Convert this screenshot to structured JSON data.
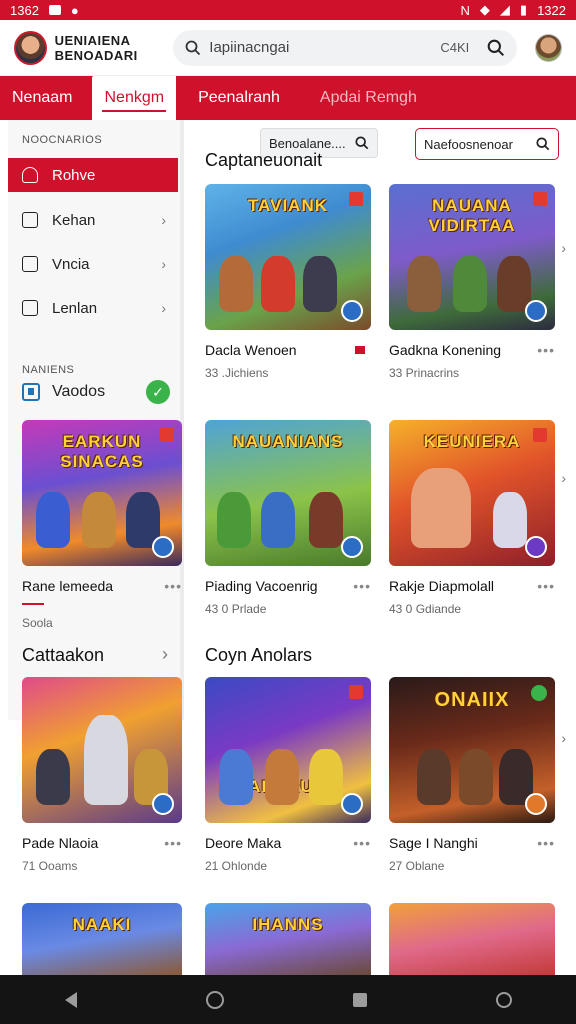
{
  "status": {
    "time_left": "1362",
    "time_right": "1322",
    "indicator": "N"
  },
  "header": {
    "brand_line1": "UENIAIENA",
    "brand_line2": "BENOADARI",
    "search_placeholder": "Iapiinacngai",
    "search_hint": "C4KI"
  },
  "nav": {
    "tabs": [
      "Nenaam",
      "Nenkgm",
      "Peenalranh",
      "Apdai Remgh"
    ],
    "active_index": 1
  },
  "sidebar": {
    "section1": "NOOCNARIOS",
    "items": [
      {
        "label": "Rohve",
        "active": true
      },
      {
        "label": "Kehan",
        "active": false
      },
      {
        "label": "Vncia",
        "active": false
      },
      {
        "label": "Lenlan",
        "active": false
      }
    ],
    "section2": "NANIENS",
    "videos_label": "Vaodos"
  },
  "filters": {
    "small_label": "Benoalane....",
    "big_label": "Naefoosnenoar"
  },
  "sections": {
    "first": "Captaneuonait",
    "second": "Cattaakon",
    "third": "Coyn Anolars"
  },
  "cards": [
    {
      "title": "Dacla Wenoen",
      "meta": "33 .Jichiens",
      "art": "TAVIANK"
    },
    {
      "title": "Gadkna Konening",
      "meta": "33 Prinacrins",
      "art": "NAUANA VIDIRTAA"
    },
    {
      "title": "Rane lemeeda",
      "meta": "Soola",
      "art": "EARKUN SINACAS"
    },
    {
      "title": "Piading Vacoenrig",
      "meta": "43 0 Prlade",
      "art": "NAUANIANS"
    },
    {
      "title": "Rakje Diapmolall",
      "meta": "43 0 Gdiande",
      "art": "KEUNIERA"
    },
    {
      "title": "Pade Nlaoia",
      "meta": "71 Ooams",
      "art": ""
    },
    {
      "title": "Deore Maka",
      "meta": "21 Ohlonde",
      "art": "SAFGRUAN"
    },
    {
      "title": "Sage I Nanghi",
      "meta": "27 Oblane",
      "art": "ONAIIX"
    },
    {
      "title": "",
      "meta": "",
      "art": "NAAKI"
    },
    {
      "title": "",
      "meta": "",
      "art": "IHANNS"
    },
    {
      "title": "",
      "meta": "",
      "art": ""
    }
  ],
  "colors": {
    "brand_red": "#d0112b",
    "check_green": "#3ab34a",
    "badge_blue": "#2b6cc4"
  },
  "icons": [
    "search-icon",
    "user-icon",
    "chevron-right-icon",
    "more-icon",
    "check-icon",
    "video-icon",
    "back-icon",
    "home-icon",
    "recents-icon",
    "accessibility-icon"
  ]
}
